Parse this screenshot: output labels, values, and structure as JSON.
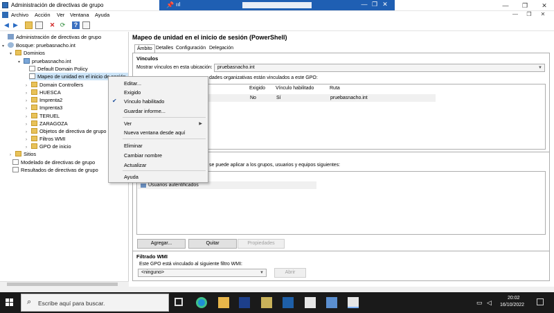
{
  "window": {
    "title": "Administración de directivas de grupo",
    "controls": [
      "—",
      "❐",
      "✕"
    ]
  },
  "rdp": {
    "pin": "📌",
    "signal": "ııl",
    "buttons": [
      "—",
      "❐",
      "✕"
    ]
  },
  "menu": {
    "items": [
      "Archivo",
      "Acción",
      "Ver",
      "Ventana",
      "Ayuda"
    ],
    "inner_controls": [
      "—",
      "❐",
      "✕"
    ]
  },
  "tree": {
    "nodes": [
      {
        "label": "Administración de directivas de grupo",
        "icon": "root",
        "arrow": ""
      },
      {
        "label": "Bosque: pruebasnacho.int",
        "icon": "forest",
        "arrow": "▾"
      },
      {
        "label": "Dominios",
        "icon": "folder",
        "arrow": "▾"
      },
      {
        "label": "pruebasnacho.int",
        "icon": "domain",
        "arrow": "▾"
      },
      {
        "label": "Default Domain Policy",
        "icon": "gpo",
        "arrow": ""
      },
      {
        "label": "Mapeo de unidad en el inicio de sesión",
        "icon": "gpo",
        "arrow": ""
      },
      {
        "label": "Domain Controllers",
        "icon": "folder",
        "arrow": "›"
      },
      {
        "label": "HUESCA",
        "icon": "folder",
        "arrow": "›"
      },
      {
        "label": "Imprenta2",
        "icon": "folder",
        "arrow": "›"
      },
      {
        "label": "Imprenta3",
        "icon": "folder",
        "arrow": "›"
      },
      {
        "label": "TERUEL",
        "icon": "folder",
        "arrow": "›"
      },
      {
        "label": "ZARAGOZA",
        "icon": "folder",
        "arrow": "›"
      },
      {
        "label": "Objetos de directiva de grupo",
        "icon": "folder",
        "arrow": "›"
      },
      {
        "label": "Filtros WMI",
        "icon": "folder",
        "arrow": "›"
      },
      {
        "label": "GPO de inicio",
        "icon": "folder",
        "arrow": "›"
      },
      {
        "label": "Sitios",
        "icon": "folder",
        "arrow": "›"
      },
      {
        "label": "Modelado de directivas de grupo",
        "icon": "gpo",
        "arrow": ""
      },
      {
        "label": "Resultados de directivas de grupo",
        "icon": "gpo",
        "arrow": ""
      }
    ]
  },
  "main": {
    "title": "Mapeo de unidad en el inicio de sesión (PowerShell)",
    "tabs": [
      "Ámbito",
      "Detalles",
      "Configuración",
      "Delegación"
    ],
    "links": {
      "heading": "Vínculos",
      "show_label": "Mostrar vínculos en esta ubicación:",
      "location_value": "pruebasnacho.int",
      "desc_suffix": "dades organizativas están vinculados a este GPO:",
      "columns": [
        "Exigido",
        "Vínculo habilitado",
        "Ruta"
      ],
      "rows": [
        {
          "enforced": "No",
          "enabled": "Sí",
          "path": "pruebasnacho.int"
        }
      ]
    },
    "security": {
      "desc_suffix": "se puede aplicar a los grupos, usuarios y equipos siguientes:",
      "items": [
        "Usuarios autentificados"
      ],
      "buttons": {
        "add": "Agregar...",
        "remove": "Quitar",
        "properties": "Propiedades"
      }
    },
    "wmi": {
      "heading": "Filtrado WMI",
      "desc": "Este GPO está vinculado al siguiente filtro WMI:",
      "value": "<ninguno>",
      "open": "Abrir"
    }
  },
  "context_menu": {
    "items": [
      {
        "label": "Editar...",
        "checked": false
      },
      {
        "label": "Exigido",
        "checked": false
      },
      {
        "label": "Vínculo habilitado",
        "checked": true
      },
      {
        "label": "Guardar informe...",
        "checked": false
      },
      {
        "label": "Ver",
        "checked": false,
        "submenu": true
      },
      {
        "label": "Nueva ventana desde aquí",
        "checked": false
      },
      {
        "label": "Eliminar",
        "checked": false
      },
      {
        "label": "Cambiar nombre",
        "checked": false
      },
      {
        "label": "Actualizar",
        "checked": false
      },
      {
        "label": "Ayuda",
        "checked": false
      }
    ]
  },
  "taskbar": {
    "search_placeholder": "Escribe aquí para buscar.",
    "time": "20:02",
    "date": "16/10/2022"
  },
  "colors": {
    "rdp_bar": "#1f5fb3",
    "selection": "#cce4f7",
    "taskbar": "#1a1a1a"
  }
}
